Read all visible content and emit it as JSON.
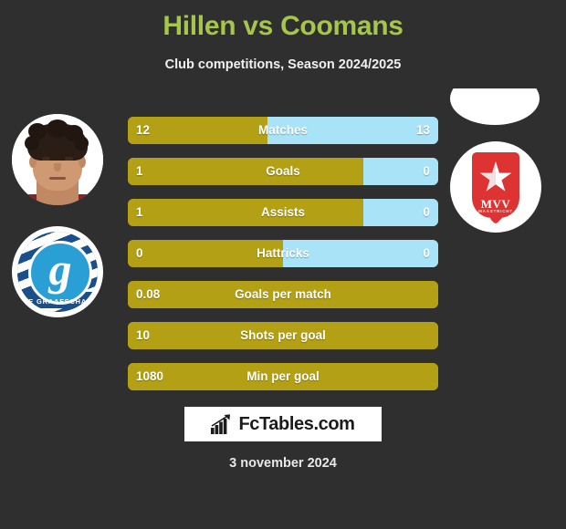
{
  "header": {
    "title": "Hillen vs Coomans",
    "subtitle": "Club competitions, Season 2024/2025",
    "title_color": "#a5c64a"
  },
  "players": {
    "left": {
      "avatar": "player-photo",
      "club_badge": "de-graafschap-badge",
      "club_name": "DE GRAAFSCHAP",
      "club_monogram": "g"
    },
    "right": {
      "avatar": "blank-player-photo",
      "club_badge": "mvv-maastricht-badge",
      "club_name": "MVV",
      "club_subname": "MAASTRICHT"
    }
  },
  "colors": {
    "background": "#2f2f2f",
    "left_bar": "#b3a014",
    "right_bar": "#a9e3f7",
    "accent": "#a5c64a"
  },
  "chart_data": {
    "type": "bar",
    "title": "Hillen vs Coomans",
    "subtitle": "Club competitions, Season 2024/2025",
    "comparison": "two-sided stacked comparison bars",
    "categories": [
      "Matches",
      "Goals",
      "Assists",
      "Hattricks",
      "Goals per match",
      "Shots per goal",
      "Min per goal"
    ],
    "series": [
      {
        "name": "Hillen",
        "values": [
          "12",
          "1",
          "1",
          "0",
          "0.08",
          "10",
          "1080"
        ]
      },
      {
        "name": "Coomans",
        "values": [
          "13",
          "0",
          "0",
          "0",
          "",
          "",
          ""
        ]
      }
    ],
    "rows": [
      {
        "label": "Matches",
        "left": "12",
        "right": "13",
        "left_pct": 45,
        "has_right": true
      },
      {
        "label": "Goals",
        "left": "1",
        "right": "0",
        "left_pct": 76,
        "has_right": true
      },
      {
        "label": "Assists",
        "left": "1",
        "right": "0",
        "left_pct": 76,
        "has_right": true
      },
      {
        "label": "Hattricks",
        "left": "0",
        "right": "0",
        "left_pct": 50,
        "has_right": true
      },
      {
        "label": "Goals per match",
        "left": "0.08",
        "right": "",
        "left_pct": 100,
        "has_right": false
      },
      {
        "label": "Shots per goal",
        "left": "10",
        "right": "",
        "left_pct": 100,
        "has_right": false
      },
      {
        "label": "Min per goal",
        "left": "1080",
        "right": "",
        "left_pct": 100,
        "has_right": false
      }
    ]
  },
  "footer": {
    "logo_text": "FcTables.com",
    "logo_icon": "bar-chart-arrow-icon",
    "date": "3 november 2024"
  }
}
